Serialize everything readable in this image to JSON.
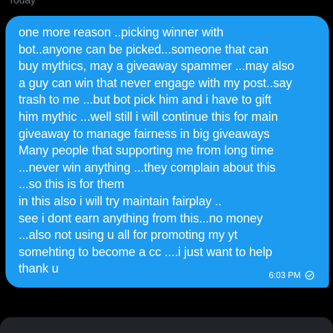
{
  "conversation": {
    "date_separator": "Today"
  },
  "message": {
    "text": "one more reason ..picking winner with\nbot..anyone can be picked...someone that can\nbuy mythics, may a giveaway spammer ...may also\na guy can win that never engage with my post..say\ntrash to me ...but bot pick him and i have to gift\nhim mythic ...well still i will continue this for main\ngiveaway to manage fairness in big giveaways\nMany people that supporting me from long time\n...never win anything ...they complain about this\n...so this is for them\nin this also i will try maintain fairplay ..\nsee i dont earn anything from this...no money\n...also not using u all for promoting my yt\nsomehting to become a cc ....i just want to help\nthank u",
    "time": "6:03 PM",
    "status_icon": "sent-check-circle-icon"
  },
  "colors": {
    "background": "#000000",
    "bubble": "#1d9bf0",
    "bubble_text": "#ffffff",
    "muted_text": "#71767b",
    "composer": "#202327"
  }
}
